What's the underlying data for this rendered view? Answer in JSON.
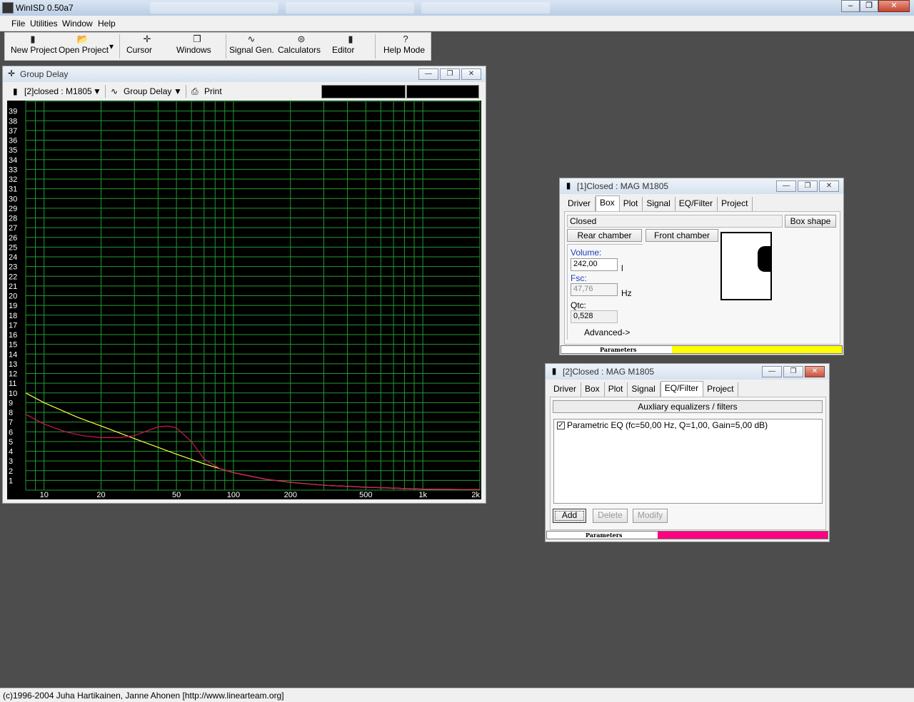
{
  "app": {
    "title": "WinISD 0.50a7",
    "window_buttons": [
      "‒",
      "❐",
      "✕"
    ]
  },
  "menu": {
    "items": [
      {
        "label": "File"
      },
      {
        "label": "Utilities"
      },
      {
        "label": "Window"
      },
      {
        "label": "Help"
      }
    ]
  },
  "toolbar": {
    "new_project": "New Project",
    "open_project": "Open Project",
    "cursor": "Cursor",
    "windows": "Windows",
    "signal_gen": "Signal Gen.",
    "calculators": "Calculators",
    "editor": "Editor",
    "help_mode": "Help Mode"
  },
  "graph_window": {
    "title": "Group Delay",
    "project_select": "[2]closed : M1805",
    "graph_type": "Group Delay",
    "print": "Print",
    "colors": {
      "background": "#000000",
      "grid": "#1f9b2e",
      "axis_text": "#ffffff"
    }
  },
  "chart_data": {
    "type": "line",
    "title": "",
    "xlabel": "",
    "ylabel": "",
    "xscale": "log",
    "xlim": [
      8,
      2000
    ],
    "ylim": [
      0,
      40
    ],
    "x_ticks": [
      "10",
      "20",
      "50",
      "100",
      "200",
      "500",
      "1k",
      "2k"
    ],
    "y_ticks": [
      "1",
      "2",
      "3",
      "4",
      "5",
      "6",
      "7",
      "8",
      "9",
      "10",
      "11",
      "12",
      "13",
      "14",
      "15",
      "16",
      "17",
      "18",
      "19",
      "20",
      "21",
      "22",
      "23",
      "24",
      "25",
      "26",
      "27",
      "28",
      "29",
      "30",
      "31",
      "32",
      "33",
      "34",
      "35",
      "36",
      "37",
      "38",
      "39"
    ],
    "grid": true,
    "series": [
      {
        "color": "#ffff40",
        "x": [
          8,
          10,
          15,
          20,
          30,
          40,
          50,
          70,
          100,
          150,
          200,
          300,
          500,
          1000,
          2000
        ],
        "y": [
          10.0,
          9.0,
          7.5,
          6.6,
          5.3,
          4.4,
          3.7,
          2.7,
          1.8,
          1.1,
          0.8,
          0.5,
          0.3,
          0.1,
          0.05
        ]
      },
      {
        "color": "#d4145a",
        "x": [
          8,
          10,
          13,
          16,
          20,
          25,
          30,
          35,
          40,
          45,
          50,
          60,
          70,
          85,
          100,
          150,
          200,
          300,
          500,
          1000,
          2000
        ],
        "y": [
          7.8,
          6.8,
          6.0,
          5.6,
          5.4,
          5.4,
          5.6,
          6.1,
          6.5,
          6.6,
          6.4,
          5.0,
          3.2,
          2.2,
          1.8,
          1.1,
          0.8,
          0.5,
          0.3,
          0.1,
          0.05
        ]
      }
    ]
  },
  "box_window": {
    "title": "[1]Closed : MAG  M1805",
    "tabs": [
      "Driver",
      "Box",
      "Plot",
      "Signal",
      "EQ/Filter",
      "Project"
    ],
    "active_tab": "Box",
    "box_type": "Closed",
    "box_shape_btn": "Box shape",
    "rear_chamber": "Rear chamber",
    "front_chamber": "Front chamber",
    "volume_label": "Volume:",
    "volume_value": "242,00",
    "volume_unit": "l",
    "fsc_label": "Fsc:",
    "fsc_value": "47,76",
    "fsc_unit": "Hz",
    "qtc_label": "Qtc:",
    "qtc_value": "0,528",
    "advanced": "Advanced->",
    "params_label": "Parameters",
    "color": "#ffff00"
  },
  "eq_window": {
    "title": "[2]Closed : MAG  M1805",
    "tabs": [
      "Driver",
      "Box",
      "Plot",
      "Signal",
      "EQ/Filter",
      "Project"
    ],
    "active_tab": "EQ/Filter",
    "section": "Auxliary equalizers / filters",
    "items": [
      {
        "checked": true,
        "label": "Parametric EQ (fc=50,00 Hz, Q=1,00, Gain=5,00 dB)"
      }
    ],
    "add": "Add",
    "delete": "Delete",
    "modify": "Modify",
    "params_label": "Parameters",
    "color": "#ff0080"
  },
  "status": {
    "text": "(c)1996-2004 Juha Hartikainen, Janne Ahonen [http://www.linearteam.org]"
  }
}
